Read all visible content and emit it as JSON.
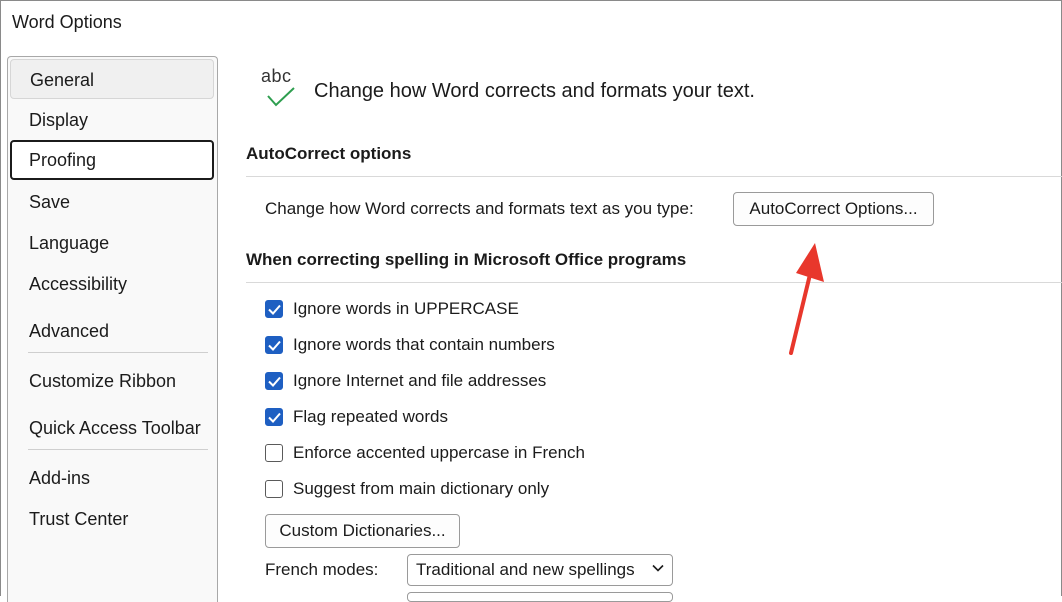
{
  "window": {
    "title": "Word Options"
  },
  "sidebar": {
    "items": [
      {
        "label": "General"
      },
      {
        "label": "Display"
      },
      {
        "label": "Proofing"
      },
      {
        "label": "Save"
      },
      {
        "label": "Language"
      },
      {
        "label": "Accessibility"
      },
      {
        "label": "Advanced"
      },
      {
        "label": "Customize Ribbon"
      },
      {
        "label": "Quick Access Toolbar"
      },
      {
        "label": "Add-ins"
      },
      {
        "label": "Trust Center"
      }
    ],
    "active": "Proofing"
  },
  "header": {
    "icon_text": "abc",
    "title": "Change how Word corrects and formats your text."
  },
  "autocorrect": {
    "section_title": "AutoCorrect options",
    "description": "Change how Word corrects and formats text as you type:",
    "button_label": "AutoCorrect Options..."
  },
  "spelling": {
    "section_title": "When correcting spelling in Microsoft Office programs",
    "options": [
      {
        "label": "Ignore words in UPPERCASE",
        "checked": true
      },
      {
        "label": "Ignore words that contain numbers",
        "checked": true
      },
      {
        "label": "Ignore Internet and file addresses",
        "checked": true
      },
      {
        "label": "Flag repeated words",
        "checked": true
      },
      {
        "label": "Enforce accented uppercase in French",
        "checked": false
      },
      {
        "label": "Suggest from main dictionary only",
        "checked": false
      }
    ],
    "custom_dictionaries_label": "Custom Dictionaries...",
    "french_modes_label": "French modes:",
    "french_modes_value": "Traditional and new spellings"
  },
  "colors": {
    "checkbox_accent": "#1e5fc2",
    "annotation_arrow": "#e8372c",
    "check_icon": "#2e9e4f"
  }
}
